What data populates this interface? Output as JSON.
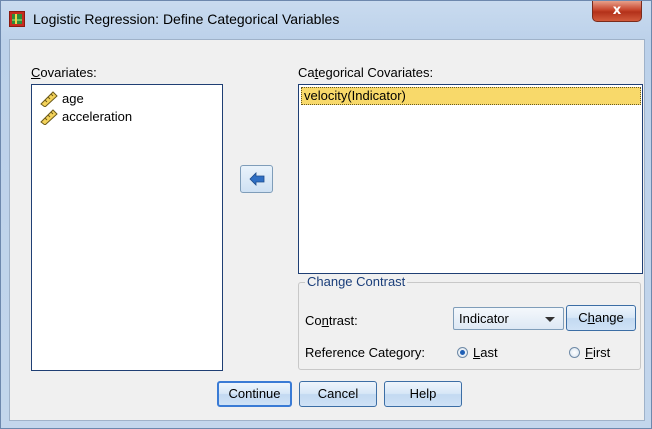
{
  "window": {
    "title": "Logistic Regression: Define Categorical Variables",
    "close_glyph": "x"
  },
  "covariates": {
    "label_mnemonic": "C",
    "label_rest": "ovariates:",
    "items": [
      {
        "label": "age",
        "icon": "scale-ruler-icon"
      },
      {
        "label": "acceleration",
        "icon": "scale-ruler-icon"
      }
    ]
  },
  "categorical": {
    "label_pre": "Ca",
    "label_mnemonic": "t",
    "label_rest": "egorical Covariates:",
    "items": [
      {
        "label": "velocity(Indicator)",
        "selected": true
      }
    ]
  },
  "move_button": {
    "icon": "left-arrow-icon"
  },
  "change_contrast": {
    "title": "Change Contrast",
    "contrast_label_pre": "Co",
    "contrast_label_mnemonic": "n",
    "contrast_label_rest": "trast:",
    "contrast_value": "Indicator",
    "change_button_pre": "C",
    "change_button_mnemonic": "h",
    "change_button_rest": "ange",
    "reference_label": "Reference Category:",
    "last_mnemonic": "L",
    "last_rest": "ast",
    "first_mnemonic": "F",
    "first_rest": "irst",
    "selected_reference": "Last"
  },
  "buttons": {
    "continue": "Continue",
    "cancel": "Cancel",
    "help": "Help"
  },
  "colors": {
    "selection": "#f8d96a",
    "accent": "#3a7bd5"
  }
}
